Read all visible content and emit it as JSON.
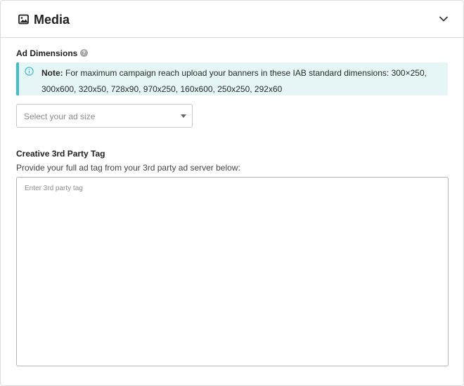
{
  "header": {
    "icon": "image-icon",
    "title": "Media",
    "toggle_icon": "chevron-down-icon"
  },
  "ad_dimensions": {
    "label": "Ad Dimensions",
    "help_icon": "question-circle-icon",
    "note": {
      "icon": "info-circle-icon",
      "accent_color": "#3fbfca",
      "background_color": "#e6f6f7",
      "prefix": "Note:",
      "text": " For maximum campaign reach upload your banners in these IAB standard dimensions: 300×250, 300x600, 320x50, 728x90, 970x250, 160x600, 250x250, 292x60"
    },
    "select": {
      "placeholder": "Select your ad size",
      "caret_icon": "caret-down-icon"
    }
  },
  "third_party_tag": {
    "label": "Creative 3rd Party Tag",
    "description": "Provide your full ad tag from your 3rd party ad server below:",
    "textarea_value": "",
    "textarea_placeholder": "Enter 3rd party tag"
  }
}
